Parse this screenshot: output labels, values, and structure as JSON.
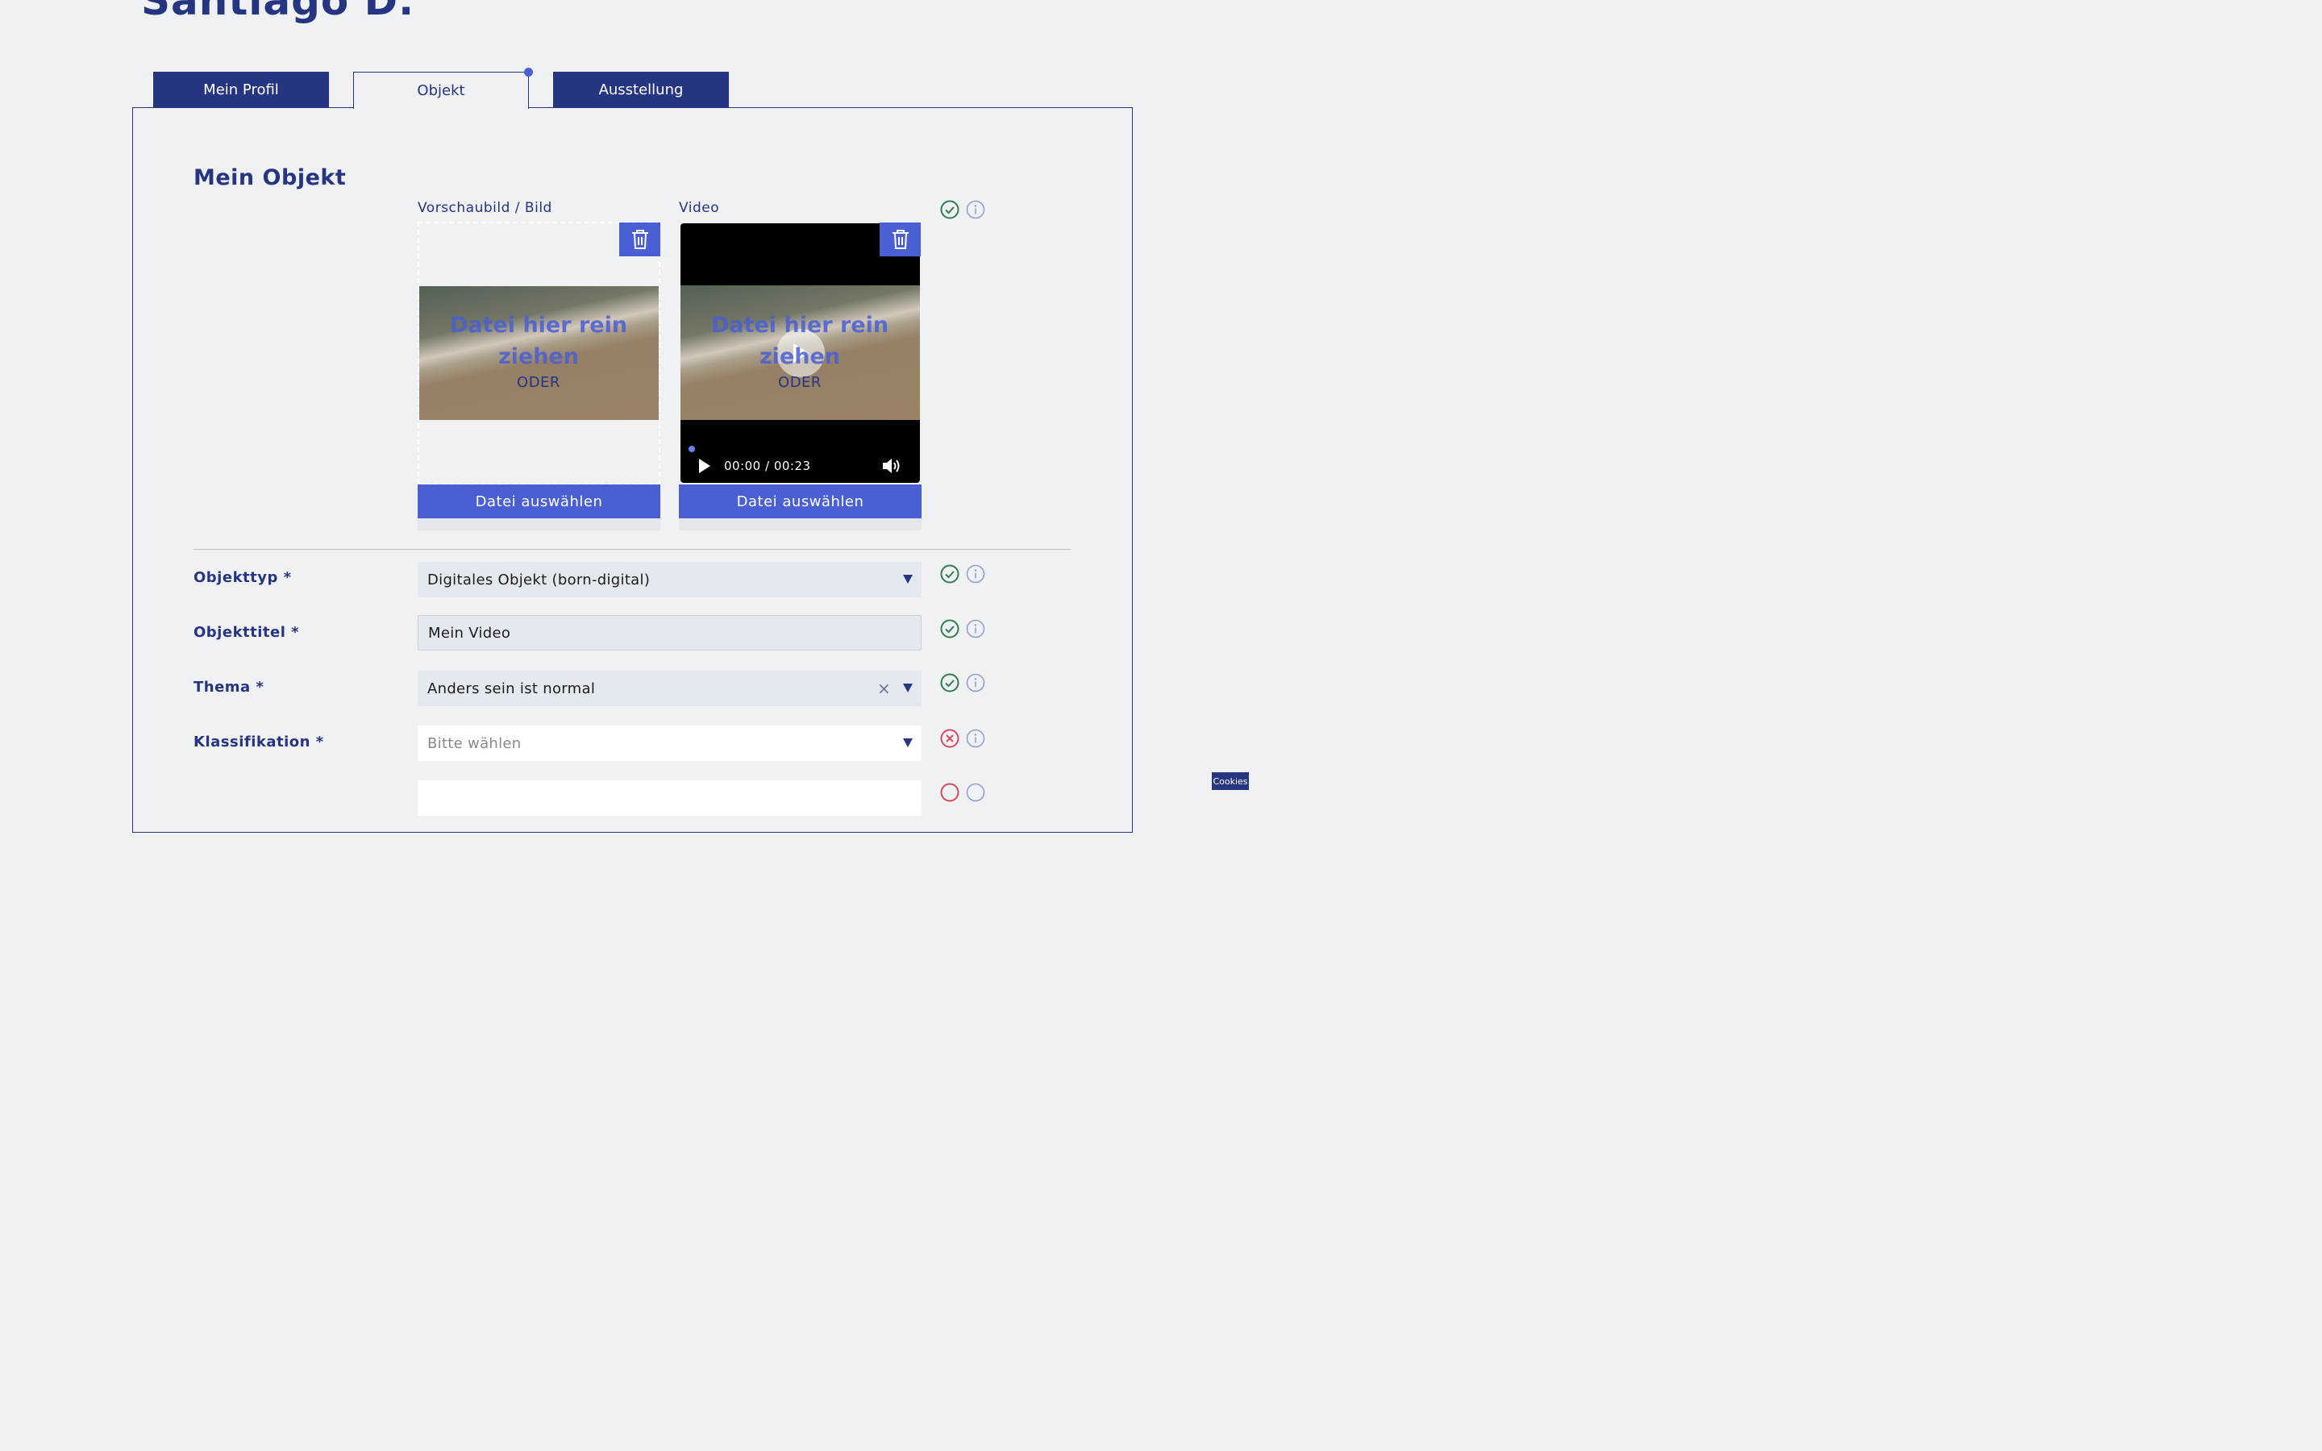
{
  "header": {
    "user_name": "Santiago D."
  },
  "tabs": [
    {
      "label": "Mein Profil",
      "active": false
    },
    {
      "label": "Objekt",
      "active": true
    },
    {
      "label": "Ausstellung",
      "active": false
    }
  ],
  "section": {
    "title": "Mein Objekt"
  },
  "media": {
    "image": {
      "label": "Vorschaubild / Bild",
      "drop_text": "Datei hier rein ziehen",
      "or_text": "ODER",
      "choose_label": "Datei auswählen",
      "delete_icon": "trash-icon"
    },
    "video": {
      "label": "Video",
      "drop_text": "Datei hier rein ziehen",
      "or_text": "ODER",
      "choose_label": "Datei auswählen",
      "time": "00:00 / 00:23",
      "delete_icon": "trash-icon"
    },
    "status": "valid"
  },
  "form": {
    "fields": [
      {
        "label": "Objekttyp *",
        "value": "Digitales Objekt (born-digital)",
        "type": "select",
        "status": "valid"
      },
      {
        "label": "Objekttitel *",
        "value": "Mein Video",
        "type": "text",
        "status": "valid"
      },
      {
        "label": "Thema *",
        "value": "Anders sein ist normal",
        "type": "select-clearable",
        "status": "valid"
      },
      {
        "label": "Klassifikation *",
        "placeholder": "Bitte wählen",
        "type": "select",
        "status": "invalid"
      }
    ]
  },
  "colors": {
    "brand_dark": "#263582",
    "brand_accent": "#4a5fd4",
    "valid": "#2e7d4f",
    "invalid": "#d9475c",
    "info": "#8e9bd8"
  },
  "cookies_label": "Cookies"
}
